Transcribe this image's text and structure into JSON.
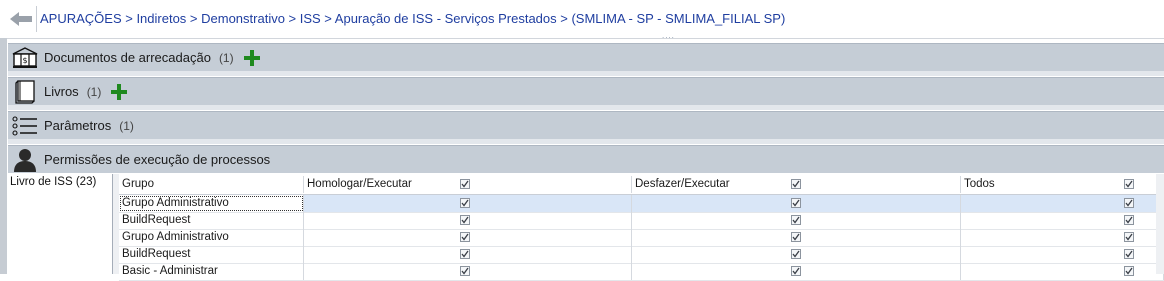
{
  "breadcrumb": {
    "text": "APURAÇÕES > Indiretos > Demonstrativo > ISS > Apuração de ISS - Serviços Prestados > (SMLIMA - SP - SMLIMA_FILIAL SP)",
    "grip": "....",
    "back_icon": "arrow-left-icon"
  },
  "sections": [
    {
      "title": "Documentos de arrecadação",
      "count": "(1)",
      "icon": "document-stamp-icon",
      "has_add": true
    },
    {
      "title": "Livros",
      "count": "(1)",
      "icon": "book-icon",
      "has_add": true
    },
    {
      "title": "Parâmetros",
      "count": "(1)",
      "icon": "list-icon",
      "has_add": false
    },
    {
      "title": "Permissões de execução de processos",
      "count": "",
      "icon": "user-icon",
      "has_add": false
    }
  ],
  "left_list": {
    "items": [
      "Livro de ISS (23)"
    ]
  },
  "grid": {
    "columns": [
      "Grupo",
      "Homologar/Executar",
      "Desfazer/Executar",
      "Todos"
    ],
    "header_checks": [
      true,
      true,
      true
    ],
    "rows": [
      {
        "group": "Grupo Administrativo",
        "checks": [
          true,
          true,
          true
        ],
        "selected": true
      },
      {
        "group": "BuildRequest",
        "checks": [
          true,
          true,
          true
        ],
        "selected": false
      },
      {
        "group": "Grupo Administrativo",
        "checks": [
          true,
          true,
          true
        ],
        "selected": false
      },
      {
        "group": "BuildRequest",
        "checks": [
          true,
          true,
          true
        ],
        "selected": false
      },
      {
        "group": "Basic - Administrar",
        "checks": [
          true,
          true,
          true
        ],
        "selected": false
      }
    ]
  },
  "colors": {
    "breadcrumb_text": "#1f3ea0",
    "section_bg": "#c5cdd6",
    "add_green": "#1f8a1f",
    "selected_row": "#d9e6f7"
  }
}
